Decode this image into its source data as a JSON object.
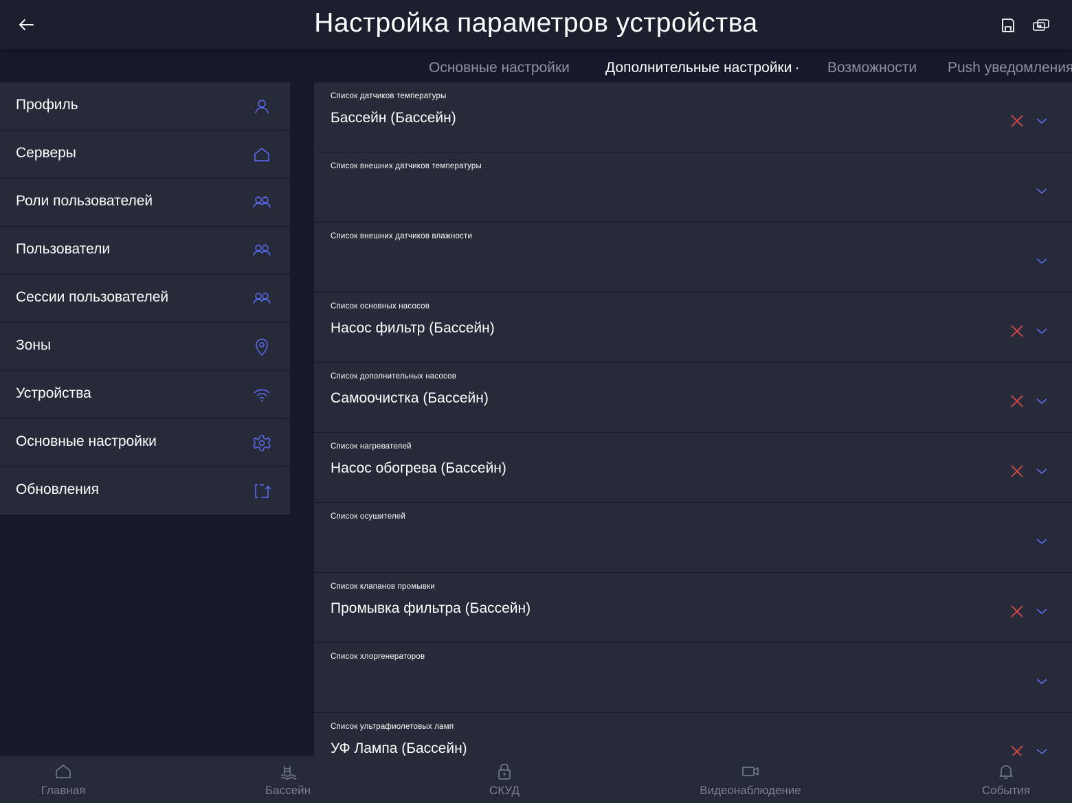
{
  "header": {
    "title": "Настройка параметров устройства",
    "back_icon": "arrow-left-icon",
    "actions": [
      "save-icon",
      "swap-icon"
    ]
  },
  "tabs": [
    {
      "label": "Основные настройки",
      "active": false
    },
    {
      "label": "Дополнительные настройки",
      "active": true,
      "indicator": "·"
    },
    {
      "label": "Возможности",
      "active": false
    },
    {
      "label": "Push уведомления",
      "active": false
    }
  ],
  "sidebar": {
    "items": [
      {
        "label": "Профиль",
        "icon": "user-icon"
      },
      {
        "label": "Серверы",
        "icon": "home-icon"
      },
      {
        "label": "Роли пользователей",
        "icon": "users-icon"
      },
      {
        "label": "Пользователи",
        "icon": "users-icon"
      },
      {
        "label": "Сессии пользователей",
        "icon": "users-icon"
      },
      {
        "label": "Зоны",
        "icon": "location-pin-icon"
      },
      {
        "label": "Устройства",
        "icon": "wifi-icon"
      },
      {
        "label": "Основные настройки",
        "icon": "gear-icon"
      },
      {
        "label": "Обновления",
        "icon": "update-icon"
      }
    ]
  },
  "fields": [
    {
      "label": "Список датчиков температуры",
      "value": "Бассейн (Бассейн)"
    },
    {
      "label": "Список внешних датчиков температуры",
      "value": ""
    },
    {
      "label": "Список внешних датчиков влажности",
      "value": ""
    },
    {
      "label": "Список основных насосов",
      "value": "Насос фильтр (Бассейн)"
    },
    {
      "label": "Список дополнительных насосов",
      "value": "Самоочистка (Бассейн)"
    },
    {
      "label": "Список нагревателей",
      "value": "Насос обогрева (Бассейн)"
    },
    {
      "label": "Список осушителей",
      "value": ""
    },
    {
      "label": "Список клапанов промывки",
      "value": "Промывка фильтра (Бассейн)"
    },
    {
      "label": "Список хлоргенераторов",
      "value": ""
    },
    {
      "label": "Список ультрафиолетовых ламп",
      "value": "УФ Лампа (Бассейн)"
    }
  ],
  "bottom_nav": [
    {
      "label": "Главная",
      "icon": "home-icon"
    },
    {
      "label": "Бассейн",
      "icon": "pool-icon"
    },
    {
      "label": "СКУД",
      "icon": "lock-icon"
    },
    {
      "label": "Видеонаблюдение",
      "icon": "video-camera-icon"
    },
    {
      "label": "События",
      "icon": "bell-icon"
    }
  ],
  "colors": {
    "background": "#151a2a",
    "panel": "#272b39",
    "accent": "#5b6ef5",
    "clear": "#e0454a",
    "muted_text": "#8c92a4"
  }
}
